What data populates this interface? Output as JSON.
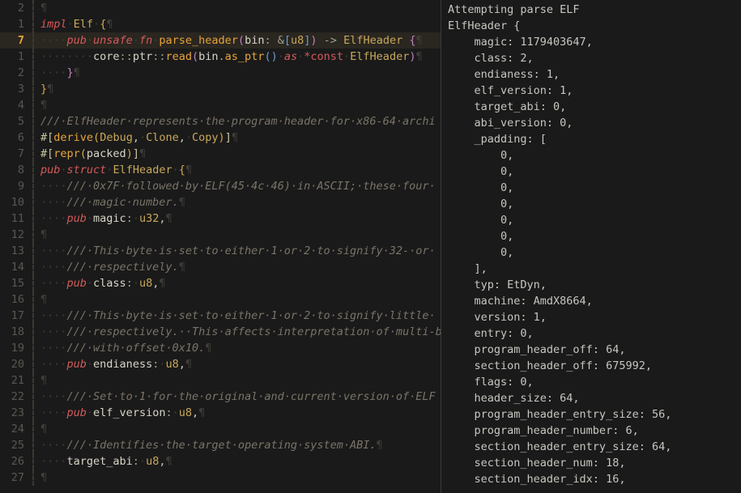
{
  "editor": {
    "lines": [
      {
        "num": "2",
        "hl": false,
        "tokens": [
          {
            "t": "nl",
            "s": "¶"
          }
        ]
      },
      {
        "num": "1",
        "hl": false,
        "tokens": [
          {
            "t": "kw-red",
            "s": "impl"
          },
          {
            "t": "ws",
            "s": "·"
          },
          {
            "t": "ty-n",
            "s": "Elf"
          },
          {
            "t": "ws",
            "s": "·"
          },
          {
            "t": "brace-y",
            "s": "{"
          },
          {
            "t": "nl",
            "s": "¶"
          }
        ]
      },
      {
        "num": "7",
        "hl": true,
        "tokens": [
          {
            "t": "ws",
            "s": "····"
          },
          {
            "t": "kw-red",
            "s": "pub"
          },
          {
            "t": "ws",
            "s": "·"
          },
          {
            "t": "kw-red",
            "s": "unsafe"
          },
          {
            "t": "ws",
            "s": "·"
          },
          {
            "t": "kw-red",
            "s": "fn"
          },
          {
            "t": "ws",
            "s": "·"
          },
          {
            "t": "fn",
            "s": "parse_header"
          },
          {
            "t": "paren-p",
            "s": "("
          },
          {
            "t": "field",
            "s": "bin"
          },
          {
            "t": "op",
            "s": ": "
          },
          {
            "t": "op",
            "s": "&"
          },
          {
            "t": "paren-b",
            "s": "["
          },
          {
            "t": "ty-n",
            "s": "u8"
          },
          {
            "t": "paren-b",
            "s": "]"
          },
          {
            "t": "paren-p",
            "s": ")"
          },
          {
            "t": "op",
            "s": " -> "
          },
          {
            "t": "ty-n",
            "s": "ElfHeader"
          },
          {
            "t": "punct",
            "s": " "
          },
          {
            "t": "paren-p",
            "s": "{"
          },
          {
            "t": "nl",
            "s": "¶"
          }
        ]
      },
      {
        "num": "1",
        "hl": false,
        "tokens": [
          {
            "t": "ws",
            "s": "········"
          },
          {
            "t": "field",
            "s": "core"
          },
          {
            "t": "op",
            "s": "::"
          },
          {
            "t": "field",
            "s": "ptr"
          },
          {
            "t": "op",
            "s": "::"
          },
          {
            "t": "fn",
            "s": "read"
          },
          {
            "t": "paren-p",
            "s": "("
          },
          {
            "t": "field",
            "s": "bin"
          },
          {
            "t": "op",
            "s": "."
          },
          {
            "t": "fn",
            "s": "as_ptr"
          },
          {
            "t": "paren-b",
            "s": "()"
          },
          {
            "t": "ws",
            "s": "·"
          },
          {
            "t": "kw-red",
            "s": "as"
          },
          {
            "t": "ws",
            "s": "·"
          },
          {
            "t": "kw-red-b",
            "s": "*const"
          },
          {
            "t": "ws",
            "s": "·"
          },
          {
            "t": "ty-n",
            "s": "ElfHeader"
          },
          {
            "t": "paren-p",
            "s": ")"
          },
          {
            "t": "nl",
            "s": "¶"
          }
        ]
      },
      {
        "num": "2",
        "hl": false,
        "tokens": [
          {
            "t": "ws",
            "s": "····"
          },
          {
            "t": "paren-p",
            "s": "}"
          },
          {
            "t": "nl",
            "s": "¶"
          }
        ]
      },
      {
        "num": "3",
        "hl": false,
        "tokens": [
          {
            "t": "brace-y",
            "s": "}"
          },
          {
            "t": "nl",
            "s": "¶"
          }
        ]
      },
      {
        "num": "4",
        "hl": false,
        "tokens": [
          {
            "t": "nl",
            "s": "¶"
          }
        ]
      },
      {
        "num": "5",
        "hl": false,
        "tokens": [
          {
            "t": "cmt",
            "s": "///·ElfHeader·represents·the·program·header·for·x86-64·archi"
          }
        ]
      },
      {
        "num": "6",
        "hl": false,
        "tokens": [
          {
            "t": "attr",
            "s": "#["
          },
          {
            "t": "fn",
            "s": "derive"
          },
          {
            "t": "paren-y",
            "s": "("
          },
          {
            "t": "ty-n",
            "s": "Debug"
          },
          {
            "t": "punct",
            "s": ","
          },
          {
            "t": "ws",
            "s": "·"
          },
          {
            "t": "ty-n",
            "s": "Clone"
          },
          {
            "t": "punct",
            "s": ","
          },
          {
            "t": "ws",
            "s": "·"
          },
          {
            "t": "ty-n",
            "s": "Copy"
          },
          {
            "t": "paren-y",
            "s": ")"
          },
          {
            "t": "attr",
            "s": "]"
          },
          {
            "t": "nl",
            "s": "¶"
          }
        ]
      },
      {
        "num": "7",
        "hl": false,
        "tokens": [
          {
            "t": "attr",
            "s": "#["
          },
          {
            "t": "fn",
            "s": "repr"
          },
          {
            "t": "paren-y",
            "s": "("
          },
          {
            "t": "field",
            "s": "packed"
          },
          {
            "t": "paren-y",
            "s": ")"
          },
          {
            "t": "attr",
            "s": "]"
          },
          {
            "t": "nl",
            "s": "¶"
          }
        ]
      },
      {
        "num": "8",
        "hl": false,
        "tokens": [
          {
            "t": "kw-red",
            "s": "pub"
          },
          {
            "t": "ws",
            "s": "·"
          },
          {
            "t": "kw-red",
            "s": "struct"
          },
          {
            "t": "ws",
            "s": "·"
          },
          {
            "t": "ty-n",
            "s": "ElfHeader"
          },
          {
            "t": "ws",
            "s": "·"
          },
          {
            "t": "brace-y",
            "s": "{"
          },
          {
            "t": "nl",
            "s": "¶"
          }
        ]
      },
      {
        "num": "9",
        "hl": false,
        "tokens": [
          {
            "t": "ws",
            "s": "····"
          },
          {
            "t": "cmt",
            "s": "///·0x7F·followed·by·ELF(45·4c·46)·in·ASCII;·these·four·"
          }
        ]
      },
      {
        "num": "10",
        "hl": false,
        "tokens": [
          {
            "t": "ws",
            "s": "····"
          },
          {
            "t": "cmt",
            "s": "///·magic·number."
          },
          {
            "t": "nl",
            "s": "¶"
          }
        ]
      },
      {
        "num": "11",
        "hl": false,
        "tokens": [
          {
            "t": "ws",
            "s": "····"
          },
          {
            "t": "kw-red",
            "s": "pub"
          },
          {
            "t": "ws",
            "s": "·"
          },
          {
            "t": "field",
            "s": "magic"
          },
          {
            "t": "op",
            "s": ":"
          },
          {
            "t": "ws",
            "s": "·"
          },
          {
            "t": "ty-n",
            "s": "u32"
          },
          {
            "t": "punct",
            "s": ","
          },
          {
            "t": "nl",
            "s": "¶"
          }
        ]
      },
      {
        "num": "12",
        "hl": false,
        "tokens": [
          {
            "t": "nl",
            "s": "¶"
          }
        ]
      },
      {
        "num": "13",
        "hl": false,
        "tokens": [
          {
            "t": "ws",
            "s": "····"
          },
          {
            "t": "cmt",
            "s": "///·This·byte·is·set·to·either·1·or·2·to·signify·32-·or·"
          }
        ]
      },
      {
        "num": "14",
        "hl": false,
        "tokens": [
          {
            "t": "ws",
            "s": "····"
          },
          {
            "t": "cmt",
            "s": "///·respectively."
          },
          {
            "t": "nl",
            "s": "¶"
          }
        ]
      },
      {
        "num": "15",
        "hl": false,
        "tokens": [
          {
            "t": "ws",
            "s": "····"
          },
          {
            "t": "kw-red",
            "s": "pub"
          },
          {
            "t": "ws",
            "s": "·"
          },
          {
            "t": "field",
            "s": "class"
          },
          {
            "t": "op",
            "s": ":"
          },
          {
            "t": "ws",
            "s": "·"
          },
          {
            "t": "ty-n",
            "s": "u8"
          },
          {
            "t": "punct",
            "s": ","
          },
          {
            "t": "nl",
            "s": "¶"
          }
        ]
      },
      {
        "num": "16",
        "hl": false,
        "tokens": [
          {
            "t": "nl",
            "s": "¶"
          }
        ]
      },
      {
        "num": "17",
        "hl": false,
        "tokens": [
          {
            "t": "ws",
            "s": "····"
          },
          {
            "t": "cmt",
            "s": "///·This·byte·is·set·to·either·1·or·2·to·signify·little·"
          }
        ]
      },
      {
        "num": "18",
        "hl": false,
        "tokens": [
          {
            "t": "ws",
            "s": "····"
          },
          {
            "t": "cmt",
            "s": "///·respectively.··This·affects·interpretation·of·multi-b"
          }
        ]
      },
      {
        "num": "19",
        "hl": false,
        "tokens": [
          {
            "t": "ws",
            "s": "····"
          },
          {
            "t": "cmt",
            "s": "///·with·offset·0x10."
          },
          {
            "t": "nl",
            "s": "¶"
          }
        ]
      },
      {
        "num": "20",
        "hl": false,
        "tokens": [
          {
            "t": "ws",
            "s": "····"
          },
          {
            "t": "kw-red",
            "s": "pub"
          },
          {
            "t": "ws",
            "s": "·"
          },
          {
            "t": "field",
            "s": "endianess"
          },
          {
            "t": "op",
            "s": ":"
          },
          {
            "t": "ws",
            "s": "·"
          },
          {
            "t": "ty-n",
            "s": "u8"
          },
          {
            "t": "punct",
            "s": ","
          },
          {
            "t": "nl",
            "s": "¶"
          }
        ]
      },
      {
        "num": "21",
        "hl": false,
        "tokens": [
          {
            "t": "nl",
            "s": "¶"
          }
        ]
      },
      {
        "num": "22",
        "hl": false,
        "tokens": [
          {
            "t": "ws",
            "s": "····"
          },
          {
            "t": "cmt",
            "s": "///·Set·to·1·for·the·original·and·current·version·of·ELF"
          }
        ]
      },
      {
        "num": "23",
        "hl": false,
        "tokens": [
          {
            "t": "ws",
            "s": "····"
          },
          {
            "t": "kw-red",
            "s": "pub"
          },
          {
            "t": "ws",
            "s": "·"
          },
          {
            "t": "field",
            "s": "elf_version"
          },
          {
            "t": "op",
            "s": ":"
          },
          {
            "t": "ws",
            "s": "·"
          },
          {
            "t": "ty-n",
            "s": "u8"
          },
          {
            "t": "punct",
            "s": ","
          },
          {
            "t": "nl",
            "s": "¶"
          }
        ]
      },
      {
        "num": "24",
        "hl": false,
        "tokens": [
          {
            "t": "nl",
            "s": "¶"
          }
        ]
      },
      {
        "num": "25",
        "hl": false,
        "tokens": [
          {
            "t": "ws",
            "s": "····"
          },
          {
            "t": "cmt",
            "s": "///·Identifies·the·target·operating·system·ABI."
          },
          {
            "t": "nl",
            "s": "¶"
          }
        ]
      },
      {
        "num": "26",
        "hl": false,
        "tokens": [
          {
            "t": "ws",
            "s": "····"
          },
          {
            "t": "field",
            "s": "target_abi"
          },
          {
            "t": "op",
            "s": ":"
          },
          {
            "t": "ws",
            "s": "·"
          },
          {
            "t": "ty-n",
            "s": "u8"
          },
          {
            "t": "punct",
            "s": ","
          },
          {
            "t": "nl",
            "s": "¶"
          }
        ]
      },
      {
        "num": "27",
        "hl": false,
        "tokens": [
          {
            "t": "nl",
            "s": "¶"
          }
        ]
      }
    ]
  },
  "output": {
    "lines": [
      "Attempting parse ELF",
      "ElfHeader {",
      "    magic: 1179403647,",
      "    class: 2,",
      "    endianess: 1,",
      "    elf_version: 1,",
      "    target_abi: 0,",
      "    abi_version: 0,",
      "    _padding: [",
      "        0,",
      "        0,",
      "        0,",
      "        0,",
      "        0,",
      "        0,",
      "        0,",
      "    ],",
      "    typ: EtDyn,",
      "    machine: AmdX8664,",
      "    version: 1,",
      "    entry: 0,",
      "    program_header_off: 64,",
      "    section_header_off: 675992,",
      "    flags: 0,",
      "    header_size: 64,",
      "    program_header_entry_size: 56,",
      "    program_header_number: 6,",
      "    section_header_entry_size: 64,",
      "    section_header_num: 18,",
      "    section_header_idx: 16,"
    ]
  }
}
